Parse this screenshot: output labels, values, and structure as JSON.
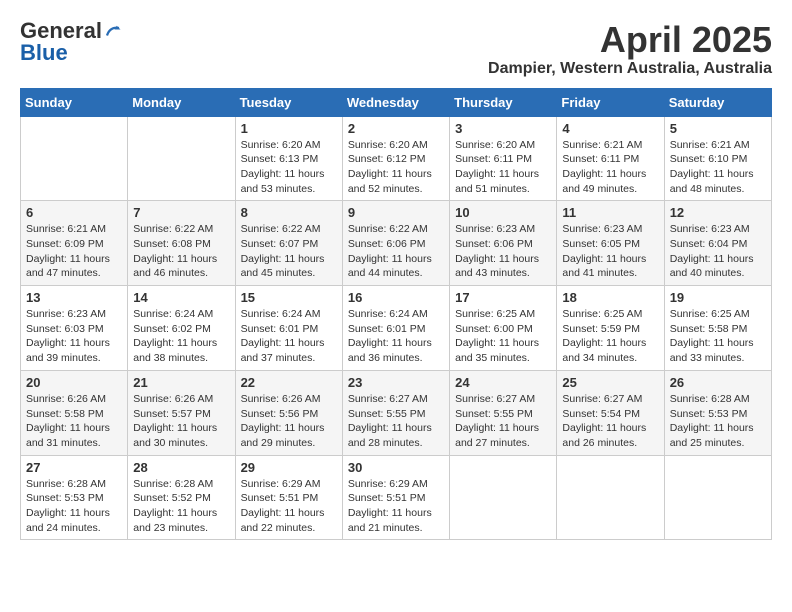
{
  "logo": {
    "general": "General",
    "blue": "Blue"
  },
  "title": "April 2025",
  "location": "Dampier, Western Australia, Australia",
  "days_header": [
    "Sunday",
    "Monday",
    "Tuesday",
    "Wednesday",
    "Thursday",
    "Friday",
    "Saturday"
  ],
  "weeks": [
    [
      {
        "day": "",
        "text": ""
      },
      {
        "day": "",
        "text": ""
      },
      {
        "day": "1",
        "text": "Sunrise: 6:20 AM\nSunset: 6:13 PM\nDaylight: 11 hours and 53 minutes."
      },
      {
        "day": "2",
        "text": "Sunrise: 6:20 AM\nSunset: 6:12 PM\nDaylight: 11 hours and 52 minutes."
      },
      {
        "day": "3",
        "text": "Sunrise: 6:20 AM\nSunset: 6:11 PM\nDaylight: 11 hours and 51 minutes."
      },
      {
        "day": "4",
        "text": "Sunrise: 6:21 AM\nSunset: 6:11 PM\nDaylight: 11 hours and 49 minutes."
      },
      {
        "day": "5",
        "text": "Sunrise: 6:21 AM\nSunset: 6:10 PM\nDaylight: 11 hours and 48 minutes."
      }
    ],
    [
      {
        "day": "6",
        "text": "Sunrise: 6:21 AM\nSunset: 6:09 PM\nDaylight: 11 hours and 47 minutes."
      },
      {
        "day": "7",
        "text": "Sunrise: 6:22 AM\nSunset: 6:08 PM\nDaylight: 11 hours and 46 minutes."
      },
      {
        "day": "8",
        "text": "Sunrise: 6:22 AM\nSunset: 6:07 PM\nDaylight: 11 hours and 45 minutes."
      },
      {
        "day": "9",
        "text": "Sunrise: 6:22 AM\nSunset: 6:06 PM\nDaylight: 11 hours and 44 minutes."
      },
      {
        "day": "10",
        "text": "Sunrise: 6:23 AM\nSunset: 6:06 PM\nDaylight: 11 hours and 43 minutes."
      },
      {
        "day": "11",
        "text": "Sunrise: 6:23 AM\nSunset: 6:05 PM\nDaylight: 11 hours and 41 minutes."
      },
      {
        "day": "12",
        "text": "Sunrise: 6:23 AM\nSunset: 6:04 PM\nDaylight: 11 hours and 40 minutes."
      }
    ],
    [
      {
        "day": "13",
        "text": "Sunrise: 6:23 AM\nSunset: 6:03 PM\nDaylight: 11 hours and 39 minutes."
      },
      {
        "day": "14",
        "text": "Sunrise: 6:24 AM\nSunset: 6:02 PM\nDaylight: 11 hours and 38 minutes."
      },
      {
        "day": "15",
        "text": "Sunrise: 6:24 AM\nSunset: 6:01 PM\nDaylight: 11 hours and 37 minutes."
      },
      {
        "day": "16",
        "text": "Sunrise: 6:24 AM\nSunset: 6:01 PM\nDaylight: 11 hours and 36 minutes."
      },
      {
        "day": "17",
        "text": "Sunrise: 6:25 AM\nSunset: 6:00 PM\nDaylight: 11 hours and 35 minutes."
      },
      {
        "day": "18",
        "text": "Sunrise: 6:25 AM\nSunset: 5:59 PM\nDaylight: 11 hours and 34 minutes."
      },
      {
        "day": "19",
        "text": "Sunrise: 6:25 AM\nSunset: 5:58 PM\nDaylight: 11 hours and 33 minutes."
      }
    ],
    [
      {
        "day": "20",
        "text": "Sunrise: 6:26 AM\nSunset: 5:58 PM\nDaylight: 11 hours and 31 minutes."
      },
      {
        "day": "21",
        "text": "Sunrise: 6:26 AM\nSunset: 5:57 PM\nDaylight: 11 hours and 30 minutes."
      },
      {
        "day": "22",
        "text": "Sunrise: 6:26 AM\nSunset: 5:56 PM\nDaylight: 11 hours and 29 minutes."
      },
      {
        "day": "23",
        "text": "Sunrise: 6:27 AM\nSunset: 5:55 PM\nDaylight: 11 hours and 28 minutes."
      },
      {
        "day": "24",
        "text": "Sunrise: 6:27 AM\nSunset: 5:55 PM\nDaylight: 11 hours and 27 minutes."
      },
      {
        "day": "25",
        "text": "Sunrise: 6:27 AM\nSunset: 5:54 PM\nDaylight: 11 hours and 26 minutes."
      },
      {
        "day": "26",
        "text": "Sunrise: 6:28 AM\nSunset: 5:53 PM\nDaylight: 11 hours and 25 minutes."
      }
    ],
    [
      {
        "day": "27",
        "text": "Sunrise: 6:28 AM\nSunset: 5:53 PM\nDaylight: 11 hours and 24 minutes."
      },
      {
        "day": "28",
        "text": "Sunrise: 6:28 AM\nSunset: 5:52 PM\nDaylight: 11 hours and 23 minutes."
      },
      {
        "day": "29",
        "text": "Sunrise: 6:29 AM\nSunset: 5:51 PM\nDaylight: 11 hours and 22 minutes."
      },
      {
        "day": "30",
        "text": "Sunrise: 6:29 AM\nSunset: 5:51 PM\nDaylight: 11 hours and 21 minutes."
      },
      {
        "day": "",
        "text": ""
      },
      {
        "day": "",
        "text": ""
      },
      {
        "day": "",
        "text": ""
      }
    ]
  ]
}
